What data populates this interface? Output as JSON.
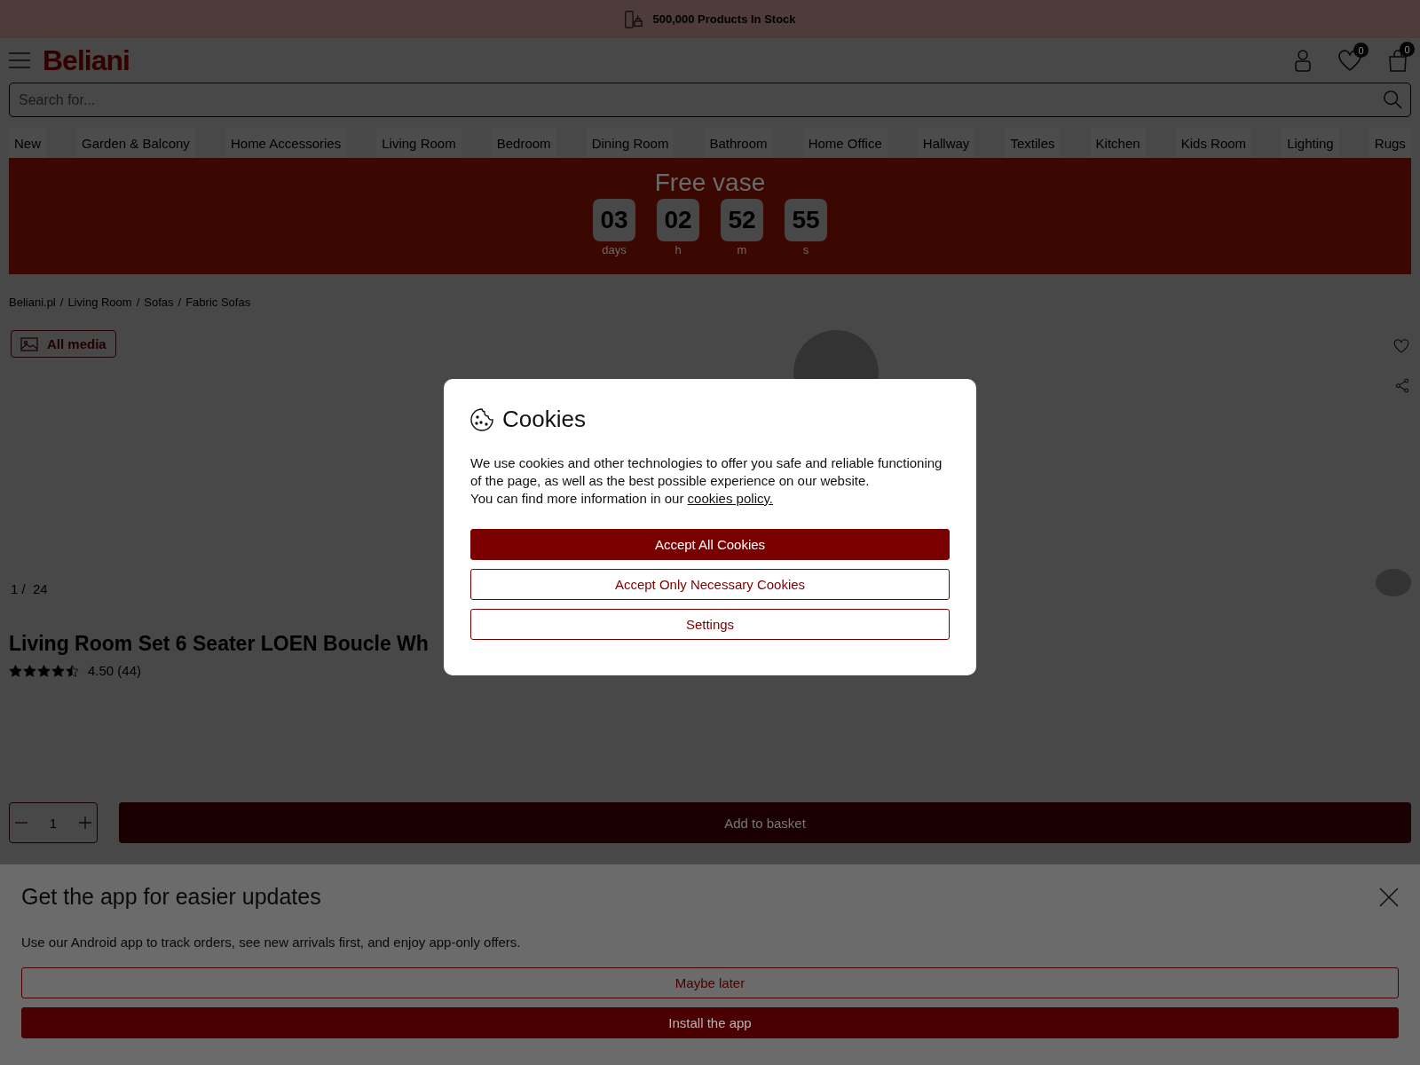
{
  "promo_bar": {
    "text": "500,000 Products In Stock"
  },
  "header": {
    "logo": "Beliani",
    "search": {
      "placeholder": "Search for..."
    },
    "wishlist_count": "0",
    "basket_count": "0"
  },
  "nav": [
    "New",
    "Garden & Balcony",
    "Home Accessories",
    "Living Room",
    "Bedroom",
    "Dining Room",
    "Bathroom",
    "Home Office",
    "Hallway",
    "Textiles",
    "Kitchen",
    "Kids Room",
    "Lighting",
    "Rugs"
  ],
  "promotion": {
    "title": "Free vase",
    "countdown": [
      {
        "value": "03",
        "unit": "days"
      },
      {
        "value": "02",
        "unit": "h"
      },
      {
        "value": "52",
        "unit": "m"
      },
      {
        "value": "55",
        "unit": "s"
      }
    ]
  },
  "breadcrumbs": {
    "separator": "/",
    "items": [
      "Beliani.pl",
      "Living Room",
      "Sofas",
      "Fabric Sofas"
    ]
  },
  "gallery": {
    "media_button": "All media",
    "counter": "1 /  24"
  },
  "product": {
    "title": "Living Room Set 6 Seater LOEN Boucle Wh",
    "stars": 4.5,
    "rating": "4.50 (44)",
    "quantity": "1",
    "add_to_basket": "Add to basket"
  },
  "cookie_dialog": {
    "title": "Cookies",
    "text": "We use cookies and other technologies to offer you safe and reliable functioning of the page, as well as the best possible experience on our website.",
    "info": "You can find more information in our",
    "link": "cookies policy.",
    "buttons": [
      {
        "label": "Accept All Cookies",
        "kind": "primary"
      },
      {
        "label": "Accept Only Necessary Cookies",
        "kind": "secondary"
      },
      {
        "label": "Settings",
        "kind": "secondary"
      }
    ]
  },
  "app_banner": {
    "title": "Get the app for easier updates",
    "text": "Use our Android app to track orders, see new arrivals first, and enjoy app-only offers.",
    "buttons": [
      {
        "label": "Maybe later",
        "kind": "secondary"
      },
      {
        "label": "Install the app",
        "kind": "primary"
      }
    ]
  }
}
